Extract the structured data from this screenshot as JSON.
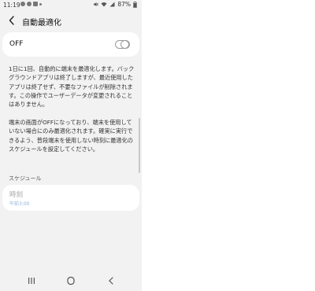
{
  "status_bar": {
    "time": "11:19",
    "battery": "87%",
    "icons": [
      "notification-icon",
      "message-icon",
      "calendar-icon",
      "mute-icon",
      "wifi-icon",
      "signal-icon",
      "battery-icon"
    ]
  },
  "header": {
    "back_icon": "back-arrow-icon",
    "title": "自動最適化"
  },
  "toggle": {
    "label": "OFF",
    "state": "off"
  },
  "description": {
    "paragraph1": "1日に1回、自動的に端末を最適化します。バックグラウンドアプリは終了しますが、最近使用したアプリは終了せず、不要なファイルが削除されます。この操作でユーザーデータが変更されることはありません。",
    "paragraph2": "端末の画面がOFFになっており、端末を使用していない場合にのみ最適化されます。確実に実行できるよう、普段端末を使用しない時刻に最適化のスケジュールを設定してください。"
  },
  "schedule": {
    "section_label": "スケジュール",
    "item_label": "時刻",
    "item_value": "午前3:00"
  },
  "nav_bar": {
    "icons": [
      "recent-apps-icon",
      "home-icon",
      "back-icon"
    ]
  },
  "colors": {
    "background": "#f2f2f2",
    "card": "#ffffff",
    "accent_value": "#8fb3dc"
  }
}
